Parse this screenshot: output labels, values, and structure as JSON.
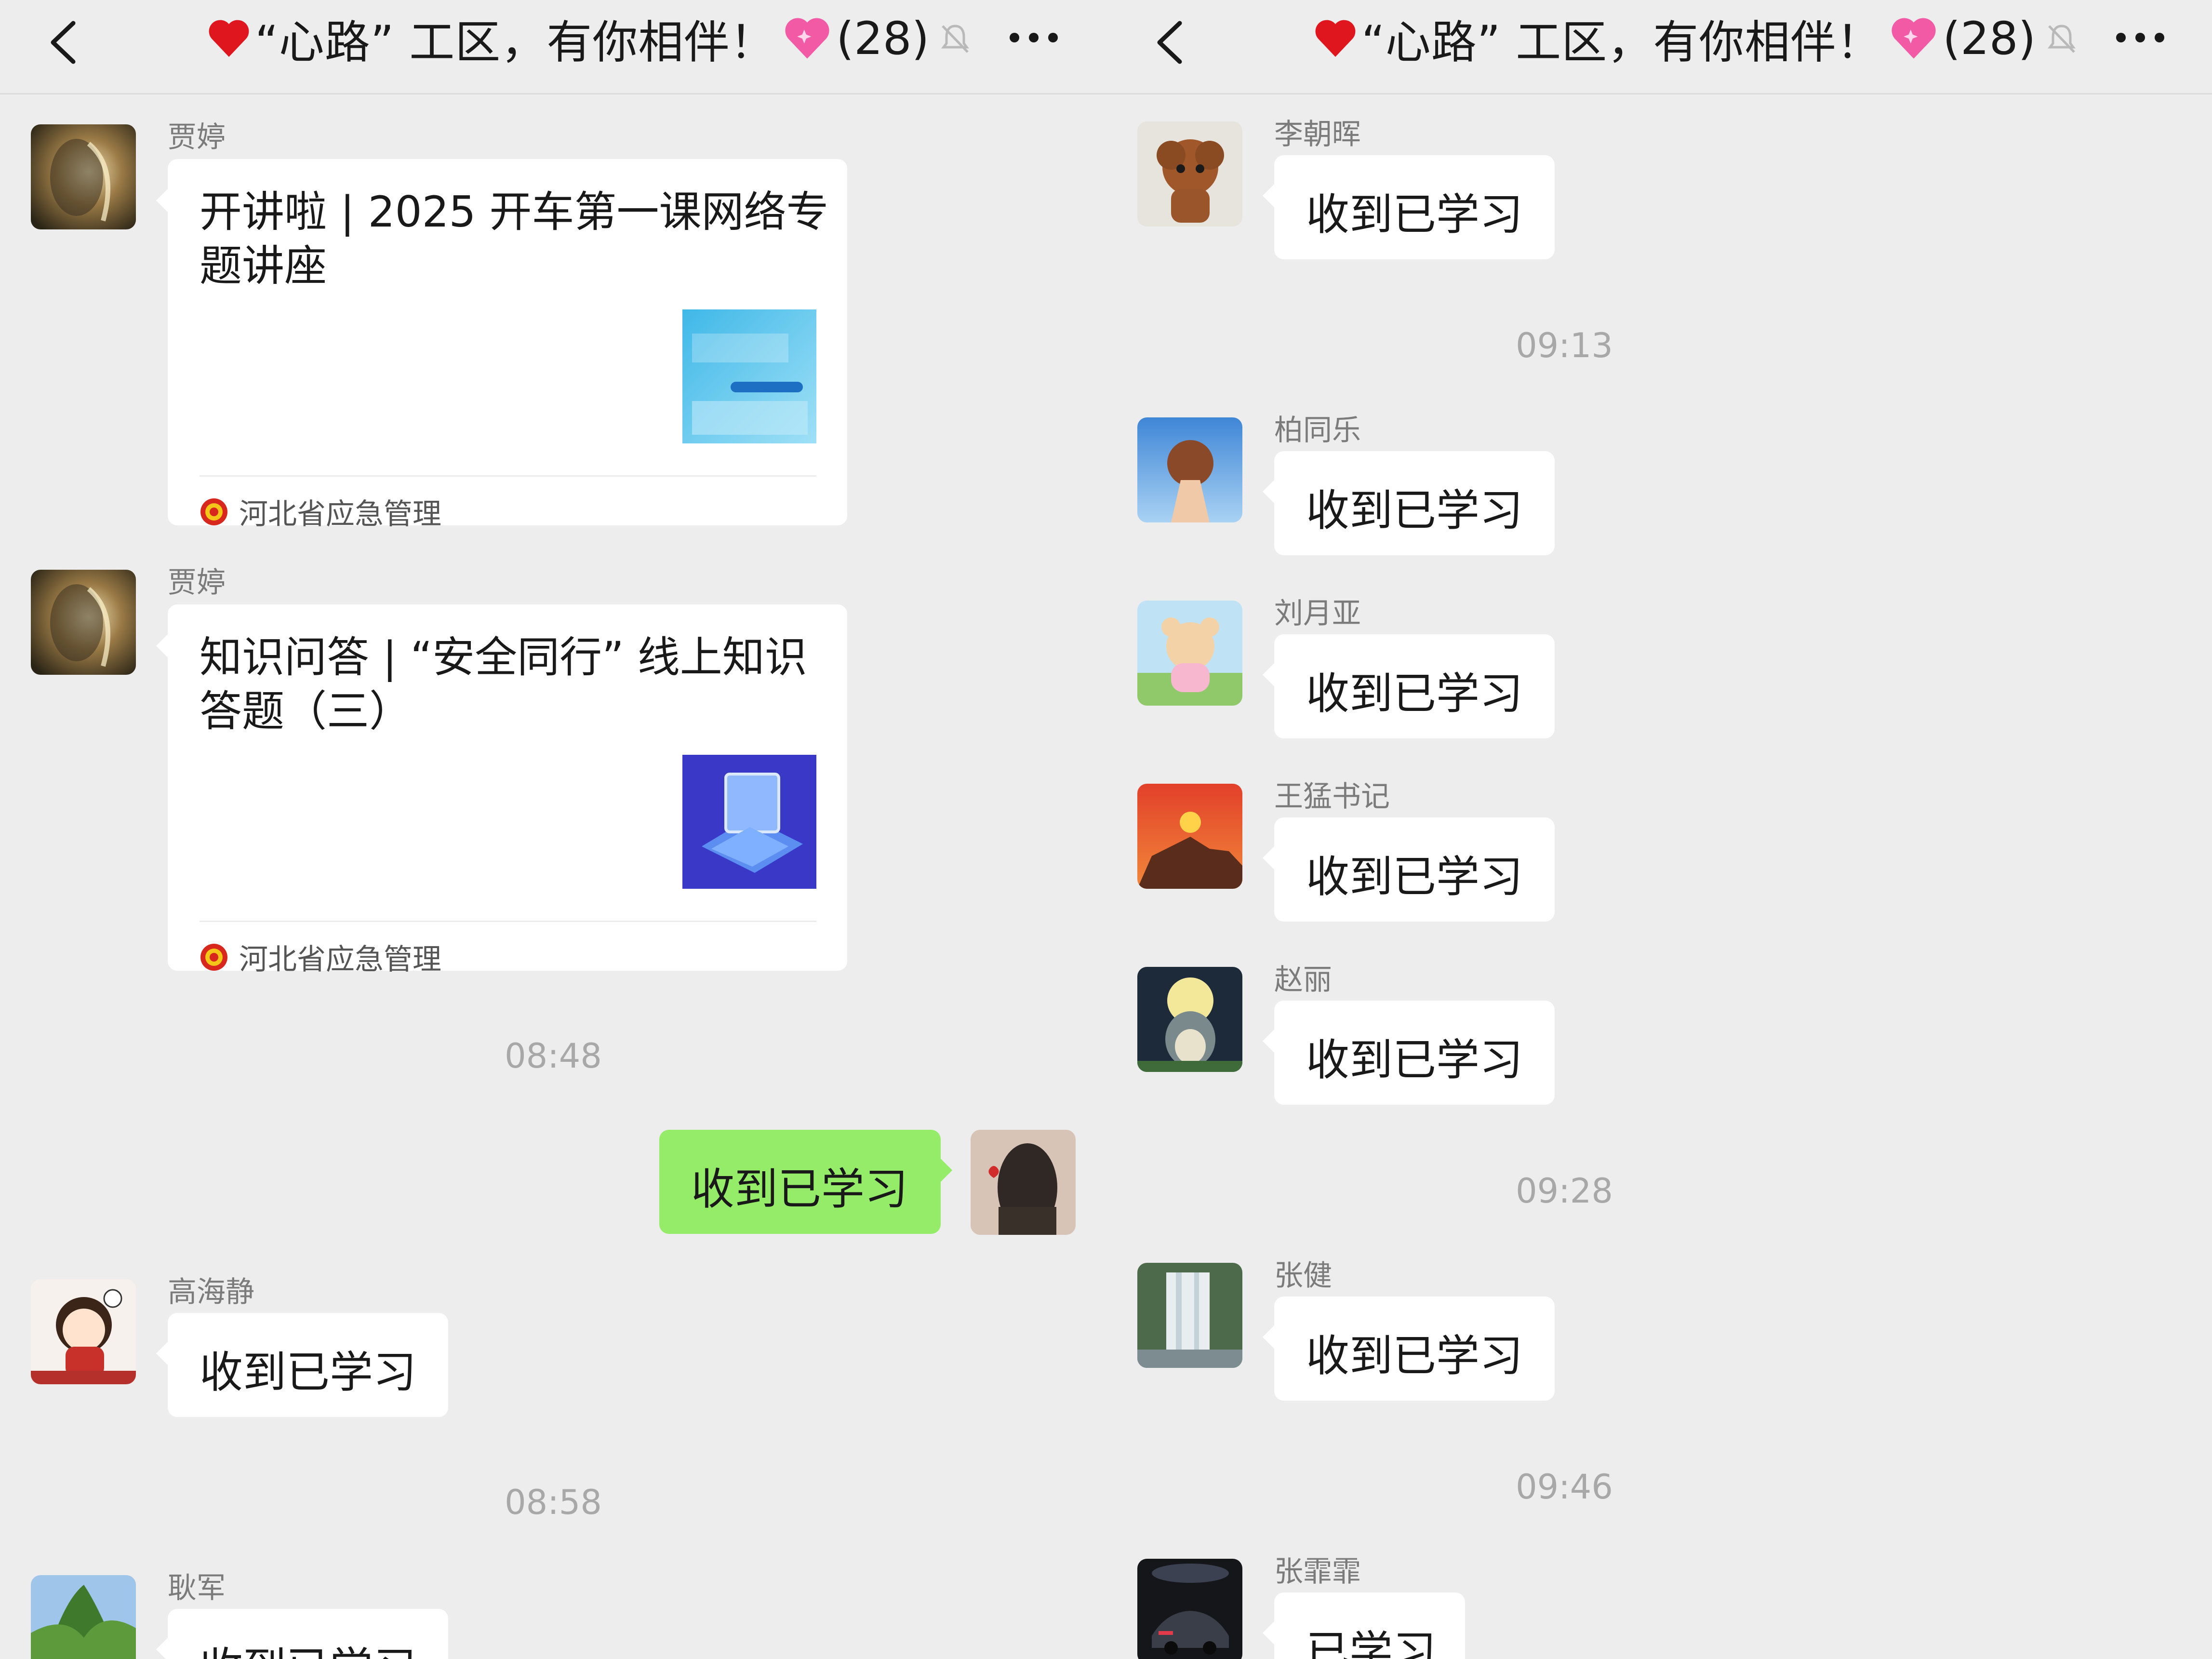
{
  "chat_title": "“心路” 工区，有你相伴！",
  "member_count": "(28)",
  "colors": {
    "background": "#ededed",
    "bubble_incoming": "#ffffff",
    "bubble_outgoing": "#95ec69",
    "timestamp": "#a8a8a8",
    "sender_name": "#7b7b7b"
  },
  "icons": {
    "back": "chevron-left-icon",
    "heart": "red-heart-icon",
    "pink_heart": "sparkling-pink-heart-icon",
    "mute": "bell-slash-icon",
    "more": "more-dots-icon"
  },
  "left": {
    "messages": [
      {
        "type": "card",
        "sender": "贾婷",
        "title": "开讲啦 | 2025 开车第一课网络专题讲座",
        "source": "河北省应急管理"
      },
      {
        "type": "card",
        "sender": "贾婷",
        "title": "知识问答 | “安全同行” 线上知识答题（三）",
        "source": "河北省应急管理"
      },
      {
        "type": "time",
        "text": "08:48"
      },
      {
        "type": "text",
        "mine": true,
        "text": "收到已学习"
      },
      {
        "type": "text",
        "sender": "高海静",
        "text": "收到已学习"
      },
      {
        "type": "time",
        "text": "08:58"
      },
      {
        "type": "text",
        "sender": "耿军",
        "text": "收到已学习"
      }
    ]
  },
  "right": {
    "messages": [
      {
        "type": "text",
        "sender": "李朝晖",
        "text": "收到已学习"
      },
      {
        "type": "time",
        "text": "09:13"
      },
      {
        "type": "text",
        "sender": "柏同乐",
        "text": "收到已学习"
      },
      {
        "type": "text",
        "sender": "刘月亚",
        "text": "收到已学习"
      },
      {
        "type": "text",
        "sender": "王猛书记",
        "text": "收到已学习"
      },
      {
        "type": "text",
        "sender": "赵丽",
        "text": "收到已学习"
      },
      {
        "type": "time",
        "text": "09:28"
      },
      {
        "type": "text",
        "sender": "张健",
        "text": "收到已学习"
      },
      {
        "type": "time",
        "text": "09:46"
      },
      {
        "type": "text",
        "sender": "张霏霏",
        "text": "已学习"
      }
    ]
  }
}
